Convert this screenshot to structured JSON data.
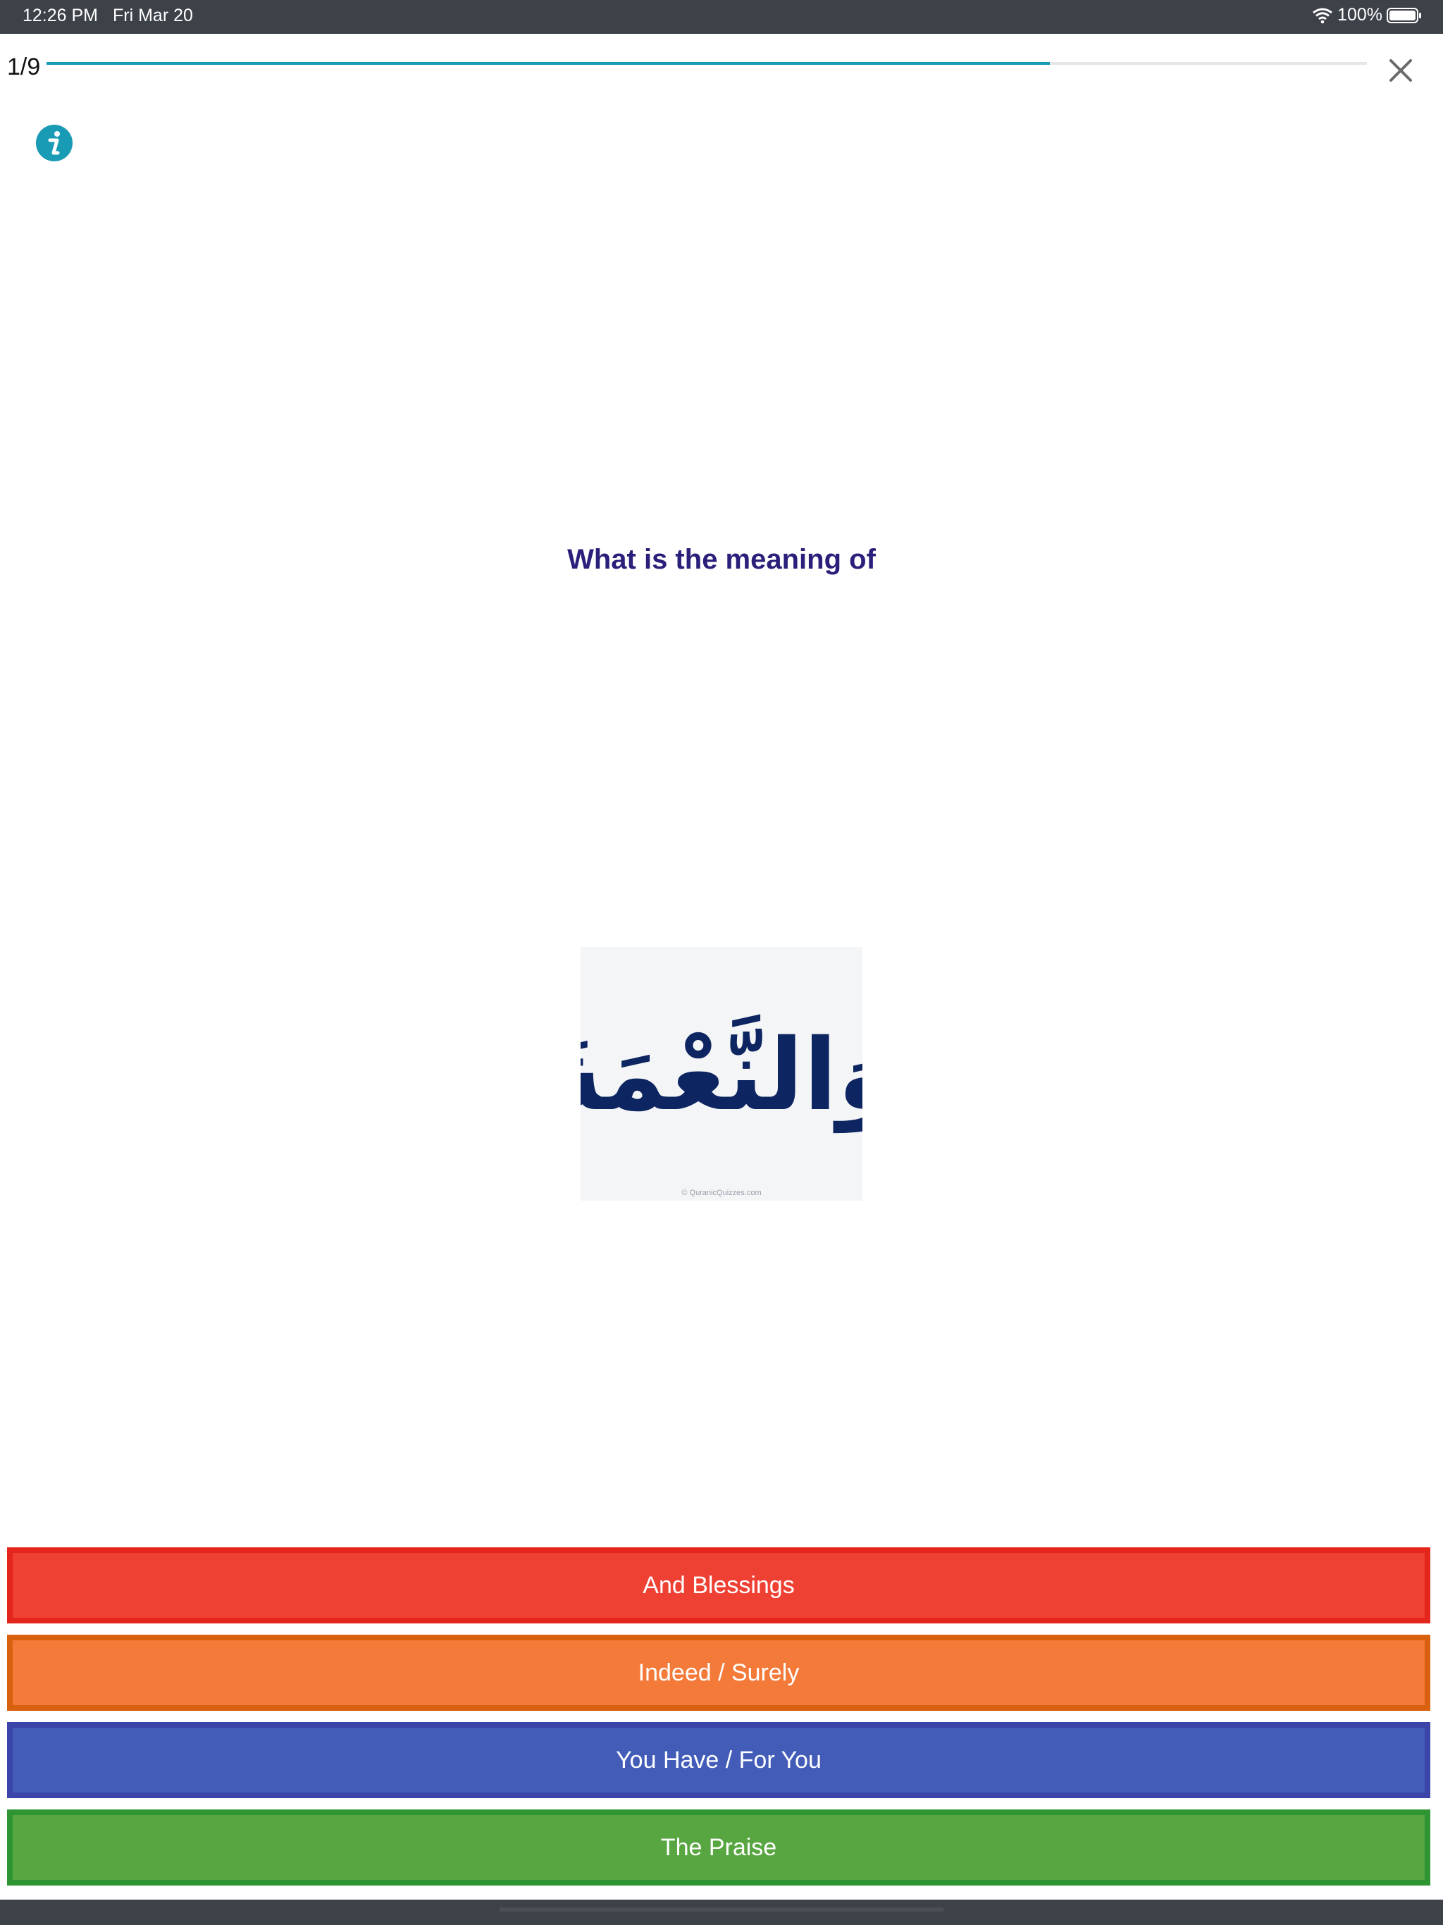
{
  "status_bar": {
    "time": "12:26 PM",
    "date": "Fri Mar 20",
    "battery": "100%",
    "icons": [
      "wifi-icon",
      "battery-icon"
    ]
  },
  "quiz": {
    "progress_label": "1/9",
    "progress_fraction": 0.76,
    "prompt": "What is the meaning of",
    "arabic_word": "وَالنَّعْمَةَ",
    "image_watermark": "© QuranicQuizzes.com",
    "answers": [
      {
        "label": "And Blessings",
        "fill": "#ef4034",
        "border": "#e3251b"
      },
      {
        "label": "Indeed / Surely",
        "fill": "#f47a3a",
        "border": "#d9600f"
      },
      {
        "label": "You Have / For You",
        "fill": "#425cb8",
        "border": "#3a44a9"
      },
      {
        "label": "The Praise",
        "fill": "#58a641",
        "border": "#2f9532"
      }
    ]
  },
  "colors": {
    "accent": "#1a9bb5",
    "prompt_text": "#2a1f7a",
    "arabic_text": "#0d2560",
    "status_bar_bg": "#3d4148"
  },
  "icons": {
    "info": "info-icon",
    "close": "close-icon"
  }
}
